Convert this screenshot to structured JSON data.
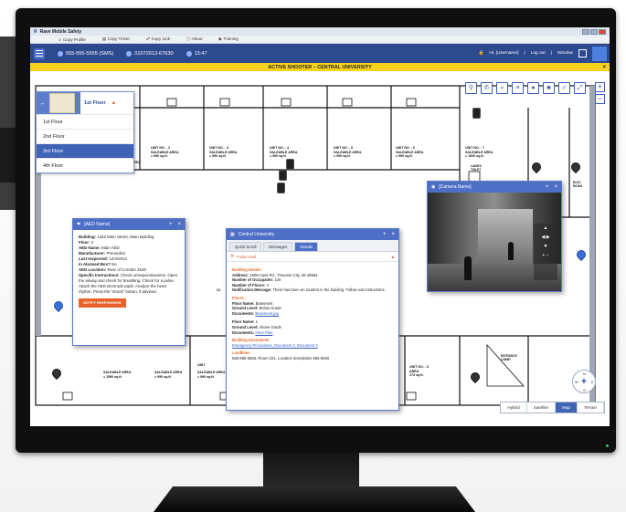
{
  "app": {
    "title": "Rave Mobile Safety"
  },
  "menu": [
    {
      "label": "Copy Profile",
      "icon": "people-icon"
    },
    {
      "label": "Copy Ticket",
      "icon": "ticket-icon"
    },
    {
      "label": "Copy Link",
      "icon": "link-icon"
    },
    {
      "label": "About",
      "icon": "info-icon"
    },
    {
      "label": "Training",
      "icon": "training-icon"
    }
  ],
  "toolbar": {
    "phone": "555-555-5555 (SMS)",
    "case": "01072013-67630",
    "time": "13:47",
    "user": "Hi, [Username]",
    "logout": "Log out",
    "window": "Window"
  },
  "alert": {
    "text": "ACTIVE SHOOTER – CENTRAL UNIVERSITY",
    "close": "×"
  },
  "floors": {
    "selected": "1st Floor",
    "items": [
      "1st Floor",
      "2nd Floor",
      "3rd Floor",
      "4th Floor"
    ],
    "active_index": 2
  },
  "map": {
    "units_top": [
      {
        "no": "UNIT NO. - 2",
        "area": "SALEABLE AREA",
        "size": "= 990 sq.ft."
      },
      {
        "no": "UNIT NO. - 3",
        "area": "SALEABLE AREA",
        "size": "= 990 sq.ft."
      },
      {
        "no": "UNIT NO. - 4",
        "area": "SALEABLE AREA",
        "size": "= 990 sq.ft."
      },
      {
        "no": "UNIT NO. - 5",
        "area": "SALEABLE AREA",
        "size": "= 990 sq.ft."
      },
      {
        "no": "UNIT NO. - 6",
        "area": "SALEABLE AREA",
        "size": "= 990 sq.ft."
      },
      {
        "no": "UNIT NO. - 7",
        "area": "SALEABLE AREA",
        "size": "= 1060 sq.ft."
      }
    ],
    "partial_top": "REA",
    "units_bottom": [
      {
        "area": "SALEABLE AREA",
        "size": "= 1590 sq.ft."
      },
      {
        "area": "SALEABLE AREA",
        "size": "= 990 sq.ft."
      },
      {
        "area": "SALEABLE AREA",
        "size": "= 990 sq.ft."
      },
      {
        "area": "UNIT NO. - 8",
        "size": "AREA"
      },
      {
        "area": "",
        "size": "273 sq.ft."
      }
    ],
    "room_labels": {
      "ladies": "LADIES TOILET",
      "sws": "SWS",
      "elec": "ELEC. ROOM",
      "entrance": "ENTRANCE LOBBY",
      "bottom_unit_left": "UNIT",
      "cc": "CC"
    }
  },
  "aed": {
    "title": "[AED Name]",
    "lines": [
      {
        "k": "Building:",
        "v": "1252 Main Street, Main Building"
      },
      {
        "k": "Floor:",
        "v": "2"
      },
      {
        "k": "AED Name:",
        "v": "Main AED"
      },
      {
        "k": "Manufacturer:",
        "v": "Premedics"
      },
      {
        "k": "Last Inspected:",
        "v": "12/4/2014"
      },
      {
        "k": "In Alarmed Box?",
        "v": "No"
      },
      {
        "k": "AED Location:",
        "v": "Rear of Corridor 2520"
      },
      {
        "k": "Specific Instructions:",
        "v": "Check unresponsiveness. Open the airway and check for breathing. Check for a pulse. Attach the AED electrode pads. Analyze the heart rhythm. Press the \"shock\" button, if advised."
      }
    ],
    "button": "NOTIFY RESPONDERS"
  },
  "central": {
    "title": "Central University",
    "tabs": [
      "Quick Scroll",
      "Messages",
      "Details"
    ],
    "active_tab": 2,
    "hall": "Fuller Hall",
    "building_head": "Building Details",
    "address": {
      "k": "Address:",
      "v": "1506 Cass Rd., Traverse City, MI 49684"
    },
    "occupants": {
      "k": "Number of Occupants:",
      "v": "120"
    },
    "floors_n": {
      "k": "Number of Floors:",
      "v": "4"
    },
    "notification": {
      "k": "Notification Message:",
      "v": "There has been an incident in the building. Follow exit instructions."
    },
    "floors_head": "Floors",
    "floor1": {
      "name_k": "Floor Name:",
      "name_v": "Basement",
      "ground_k": "Ground Level:",
      "ground_v": "Below Grade",
      "docs_k": "Documents:",
      "docs_v": "Basement.jpg"
    },
    "floor2": {
      "name_k": "Floor Name:",
      "name_v": "1",
      "ground_k": "Ground Level:",
      "ground_v": "Above Grade",
      "docs_k": "Documents:",
      "docs_v": "Floor Plan"
    },
    "bdocs_head": "Building Documents",
    "bdocs": "Emergency Procedures, Document 2, Document 3",
    "landlines_head": "Landlines",
    "landline": "555-555-5555, Room 221, Location description 555-5555"
  },
  "camera": {
    "title": "[Camera Name]"
  },
  "maptypes": {
    "items": [
      "Hybrid",
      "Satellite",
      "Map",
      "Terrain"
    ],
    "active_index": 2
  },
  "compass": {
    "n": "N",
    "s": "S",
    "e": "E",
    "w": "W"
  },
  "icons": {
    "search": "search-icon",
    "phone": "phone-icon",
    "rewind": "rewind-icon",
    "layers": "layers-icon",
    "record": "record-icon",
    "stop": "stop-icon",
    "draw": "draw-icon",
    "fullscreen": "fullscreen-icon"
  }
}
